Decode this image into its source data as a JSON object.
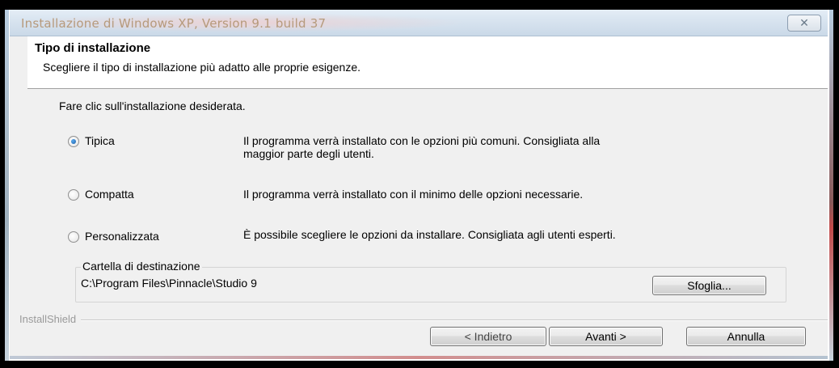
{
  "window": {
    "title": "Installazione di Windows XP, Version 9.1 build 37",
    "close_glyph": "✕"
  },
  "header": {
    "title": "Tipo di installazione",
    "subtitle": "Scegliere il tipo di installazione più adatto alle proprie esigenze."
  },
  "main": {
    "prompt": "Fare clic sull'installazione desiderata.",
    "options": [
      {
        "label": "Tipica",
        "description_line1": "Il programma verrà installato con le opzioni più comuni. Consigliata alla",
        "description_line2": "maggior parte degli utenti.",
        "selected": true
      },
      {
        "label": "Compatta",
        "description_line1": "Il programma verrà installato con il minimo delle opzioni necessarie.",
        "selected": false
      },
      {
        "label": "Personalizzata",
        "description_line1": "È possibile scegliere le opzioni da installare. Consigliata agli utenti esperti.",
        "selected": false
      }
    ],
    "destination": {
      "label": "Cartella di destinazione",
      "path": "C:\\Program Files\\Pinnacle\\Studio 9",
      "browse_label": "Sfoglia..."
    }
  },
  "footer": {
    "brand": "InstallShield",
    "back_label": "< Indietro",
    "next_label": "Avanti >",
    "cancel_label": "Annulla"
  },
  "colors": {
    "title_text": "#b69a7c",
    "radio_selected": "#1b5ea8",
    "window_bg": "#f0f0f0"
  }
}
